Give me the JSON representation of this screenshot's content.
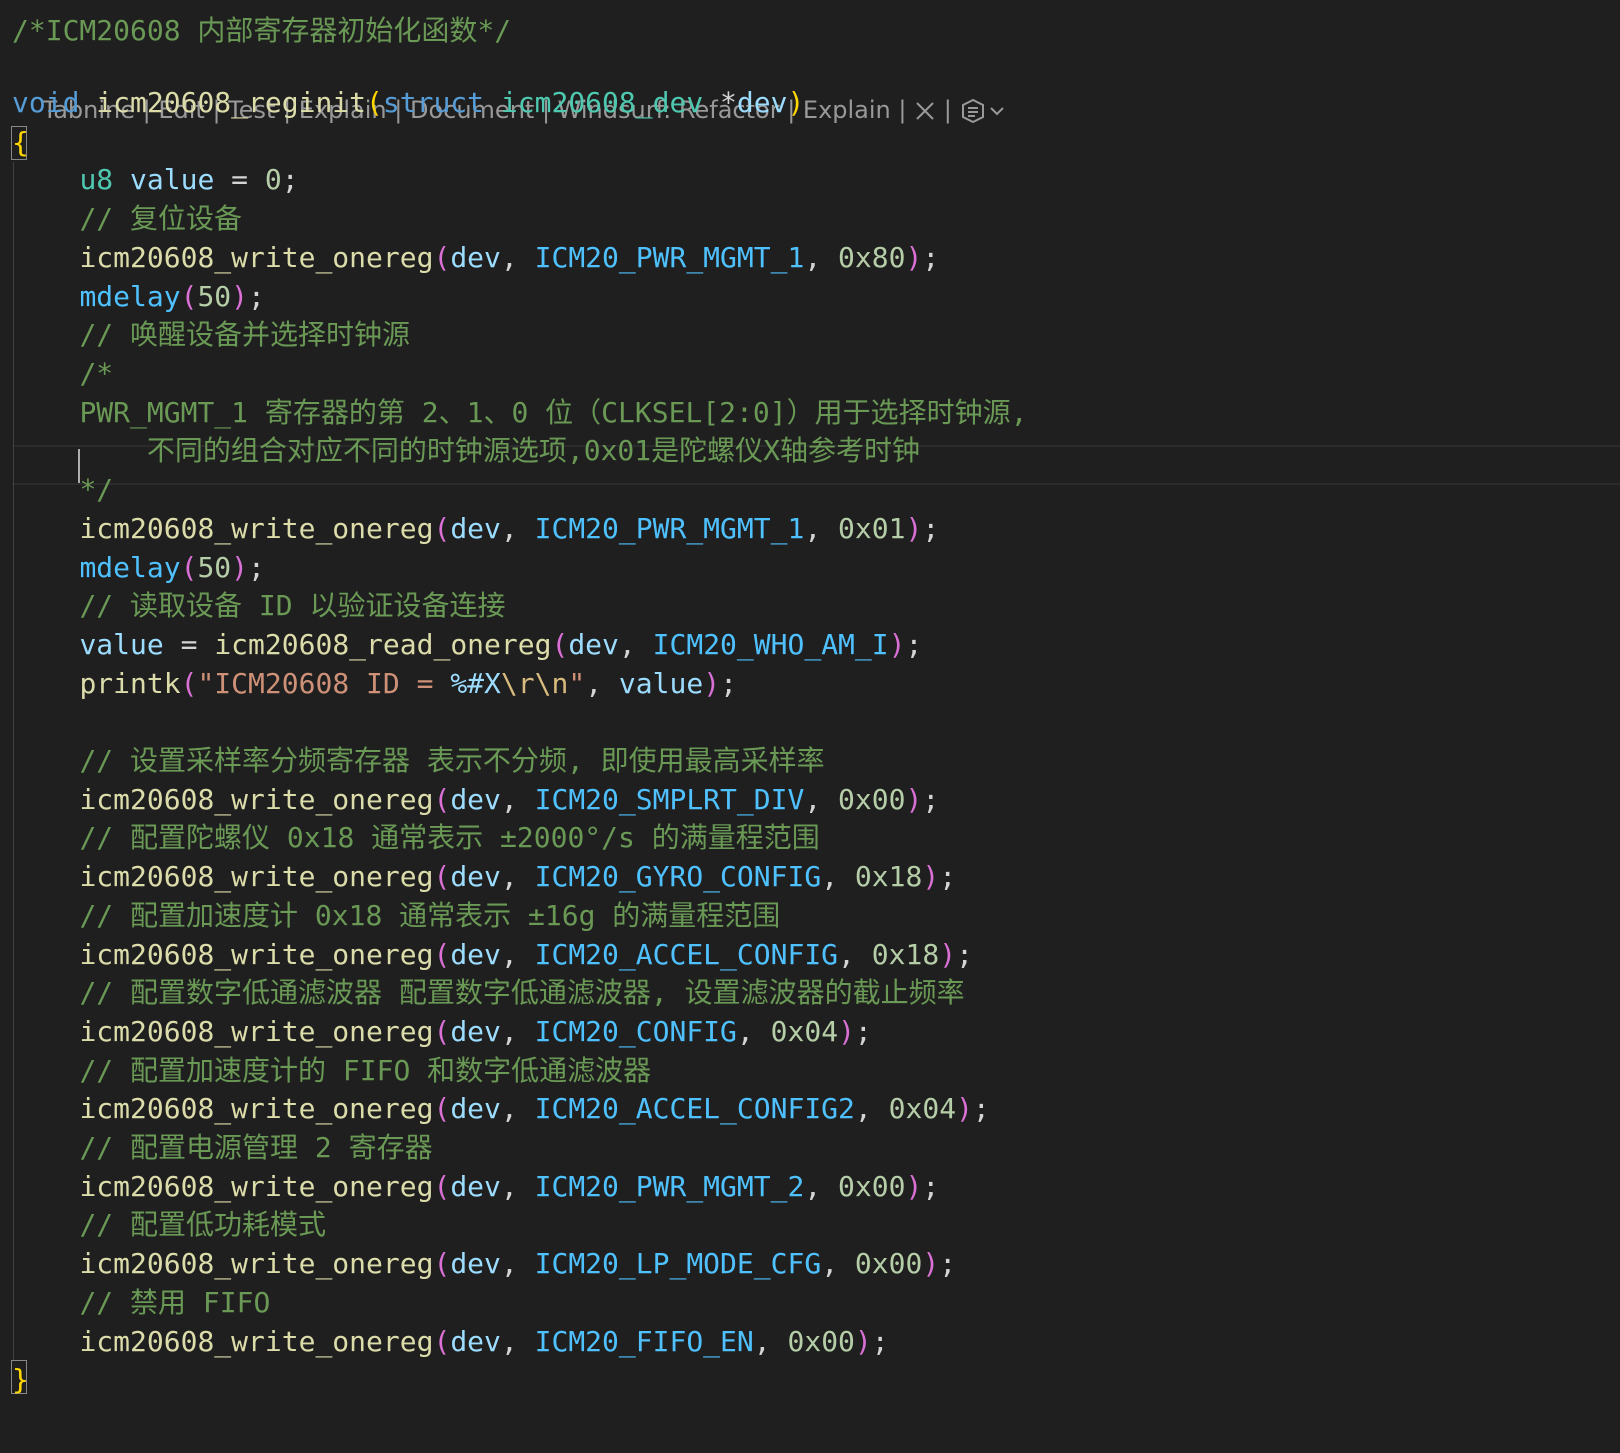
{
  "codelens": {
    "actions": [
      "Tabnine",
      "Edit",
      "Test",
      "Explain",
      "Document",
      "Windsurf: Refactor",
      "Explain"
    ],
    "separator": " | ",
    "close_icon": "close-icon",
    "windsurf_icon": "windsurf-icon",
    "chevron_icon": "chevron-down-icon"
  },
  "code": {
    "line_01": [
      [
        "cm",
        "/*ICM20608 内部寄存器初始化函数*/"
      ]
    ],
    "line_02": [
      [
        "kw",
        "void"
      ],
      [
        "op",
        " "
      ],
      [
        "fn",
        "icm20608_reginit"
      ],
      [
        "b1",
        "("
      ],
      [
        "kw",
        "struct"
      ],
      [
        "op",
        " "
      ],
      [
        "ty",
        "icm20608_dev"
      ],
      [
        "op",
        " *"
      ],
      [
        "va",
        "dev"
      ],
      [
        "b1",
        ")"
      ]
    ],
    "line_03": [
      [
        "b1",
        "{"
      ]
    ],
    "line_04": [
      [
        "op",
        "    "
      ],
      [
        "ty",
        "u8"
      ],
      [
        "op",
        " "
      ],
      [
        "va",
        "value"
      ],
      [
        "op",
        " = "
      ],
      [
        "nu",
        "0"
      ],
      [
        "op",
        ";"
      ]
    ],
    "line_05": [
      [
        "op",
        "    "
      ],
      [
        "cm",
        "// 复位设备"
      ]
    ],
    "line_06": [
      [
        "op",
        "    "
      ],
      [
        "fn",
        "icm20608_write_onereg"
      ],
      [
        "b2",
        "("
      ],
      [
        "va",
        "dev"
      ],
      [
        "op",
        ", "
      ],
      [
        "mc",
        "ICM20_PWR_MGMT_1"
      ],
      [
        "op",
        ", "
      ],
      [
        "nu",
        "0x80"
      ],
      [
        "b2",
        ")"
      ],
      [
        "op",
        ";"
      ]
    ],
    "line_07": [
      [
        "op",
        "    "
      ],
      [
        "mc",
        "mdelay"
      ],
      [
        "b2",
        "("
      ],
      [
        "nu",
        "50"
      ],
      [
        "b2",
        ")"
      ],
      [
        "op",
        ";"
      ]
    ],
    "line_08": [
      [
        "op",
        "    "
      ],
      [
        "cm",
        "// 唤醒设备并选择时钟源"
      ]
    ],
    "line_09": [
      [
        "op",
        "    "
      ],
      [
        "cm",
        "/*"
      ]
    ],
    "line_10": [
      [
        "op",
        "    "
      ],
      [
        "cm",
        "PWR_MGMT_1 寄存器的第 2、1、0 位（CLKSEL[2:0]）用于选择时钟源,"
      ]
    ],
    "line_11": [
      [
        "op",
        "        "
      ],
      [
        "cm",
        "不同的组合对应不同的时钟源选项,0x01是陀螺仪X轴参考时钟"
      ]
    ],
    "line_12": [
      [
        "op",
        "    "
      ],
      [
        "cm",
        "*/"
      ]
    ],
    "line_13": [
      [
        "op",
        "    "
      ],
      [
        "fn",
        "icm20608_write_onereg"
      ],
      [
        "b2",
        "("
      ],
      [
        "va",
        "dev"
      ],
      [
        "op",
        ", "
      ],
      [
        "mc",
        "ICM20_PWR_MGMT_1"
      ],
      [
        "op",
        ", "
      ],
      [
        "nu",
        "0x01"
      ],
      [
        "b2",
        ")"
      ],
      [
        "op",
        ";"
      ]
    ],
    "line_14": [
      [
        "op",
        "    "
      ],
      [
        "mc",
        "mdelay"
      ],
      [
        "b2",
        "("
      ],
      [
        "nu",
        "50"
      ],
      [
        "b2",
        ")"
      ],
      [
        "op",
        ";"
      ]
    ],
    "line_15": [
      [
        "op",
        "    "
      ],
      [
        "cm",
        "// 读取设备 ID 以验证设备连接"
      ]
    ],
    "line_16": [
      [
        "op",
        "    "
      ],
      [
        "va",
        "value"
      ],
      [
        "op",
        " = "
      ],
      [
        "fn",
        "icm20608_read_onereg"
      ],
      [
        "b2",
        "("
      ],
      [
        "va",
        "dev"
      ],
      [
        "op",
        ", "
      ],
      [
        "mc",
        "ICM20_WHO_AM_I"
      ],
      [
        "b2",
        ")"
      ],
      [
        "op",
        ";"
      ]
    ],
    "line_17": [
      [
        "op",
        "    "
      ],
      [
        "fn",
        "printk"
      ],
      [
        "b2",
        "("
      ],
      [
        "st",
        "\"ICM20608 ID = "
      ],
      [
        "va",
        "%#X"
      ],
      [
        "es",
        "\\r\\n"
      ],
      [
        "st",
        "\""
      ],
      [
        "op",
        ", "
      ],
      [
        "va",
        "value"
      ],
      [
        "b2",
        ")"
      ],
      [
        "op",
        ";"
      ]
    ],
    "line_18": [],
    "line_19": [
      [
        "op",
        "    "
      ],
      [
        "cm",
        "// 设置采样率分频寄存器 表示不分频, 即使用最高采样率"
      ]
    ],
    "line_20": [
      [
        "op",
        "    "
      ],
      [
        "fn",
        "icm20608_write_onereg"
      ],
      [
        "b2",
        "("
      ],
      [
        "va",
        "dev"
      ],
      [
        "op",
        ", "
      ],
      [
        "mc",
        "ICM20_SMPLRT_DIV"
      ],
      [
        "op",
        ", "
      ],
      [
        "nu",
        "0x00"
      ],
      [
        "b2",
        ")"
      ],
      [
        "op",
        ";"
      ]
    ],
    "line_21": [
      [
        "op",
        "    "
      ],
      [
        "cm",
        "// 配置陀螺仪 0x18 通常表示 ±2000°/s 的满量程范围"
      ]
    ],
    "line_22": [
      [
        "op",
        "    "
      ],
      [
        "fn",
        "icm20608_write_onereg"
      ],
      [
        "b2",
        "("
      ],
      [
        "va",
        "dev"
      ],
      [
        "op",
        ", "
      ],
      [
        "mc",
        "ICM20_GYRO_CONFIG"
      ],
      [
        "op",
        ", "
      ],
      [
        "nu",
        "0x18"
      ],
      [
        "b2",
        ")"
      ],
      [
        "op",
        ";"
      ]
    ],
    "line_23": [
      [
        "op",
        "    "
      ],
      [
        "cm",
        "// 配置加速度计 0x18 通常表示 ±16g 的满量程范围"
      ]
    ],
    "line_24": [
      [
        "op",
        "    "
      ],
      [
        "fn",
        "icm20608_write_onereg"
      ],
      [
        "b2",
        "("
      ],
      [
        "va",
        "dev"
      ],
      [
        "op",
        ", "
      ],
      [
        "mc",
        "ICM20_ACCEL_CONFIG"
      ],
      [
        "op",
        ", "
      ],
      [
        "nu",
        "0x18"
      ],
      [
        "b2",
        ")"
      ],
      [
        "op",
        ";"
      ]
    ],
    "line_25": [
      [
        "op",
        "    "
      ],
      [
        "cm",
        "// 配置数字低通滤波器 配置数字低通滤波器, 设置滤波器的截止频率"
      ]
    ],
    "line_26": [
      [
        "op",
        "    "
      ],
      [
        "fn",
        "icm20608_write_onereg"
      ],
      [
        "b2",
        "("
      ],
      [
        "va",
        "dev"
      ],
      [
        "op",
        ", "
      ],
      [
        "mc",
        "ICM20_CONFIG"
      ],
      [
        "op",
        ", "
      ],
      [
        "nu",
        "0x04"
      ],
      [
        "b2",
        ")"
      ],
      [
        "op",
        ";"
      ]
    ],
    "line_27": [
      [
        "op",
        "    "
      ],
      [
        "cm",
        "// 配置加速度计的 FIFO 和数字低通滤波器"
      ]
    ],
    "line_28": [
      [
        "op",
        "    "
      ],
      [
        "fn",
        "icm20608_write_onereg"
      ],
      [
        "b2",
        "("
      ],
      [
        "va",
        "dev"
      ],
      [
        "op",
        ", "
      ],
      [
        "mc",
        "ICM20_ACCEL_CONFIG2"
      ],
      [
        "op",
        ", "
      ],
      [
        "nu",
        "0x04"
      ],
      [
        "b2",
        ")"
      ],
      [
        "op",
        ";"
      ]
    ],
    "line_29": [
      [
        "op",
        "    "
      ],
      [
        "cm",
        "// 配置电源管理 2 寄存器"
      ]
    ],
    "line_30": [
      [
        "op",
        "    "
      ],
      [
        "fn",
        "icm20608_write_onereg"
      ],
      [
        "b2",
        "("
      ],
      [
        "va",
        "dev"
      ],
      [
        "op",
        ", "
      ],
      [
        "mc",
        "ICM20_PWR_MGMT_2"
      ],
      [
        "op",
        ", "
      ],
      [
        "nu",
        "0x00"
      ],
      [
        "b2",
        ")"
      ],
      [
        "op",
        ";"
      ]
    ],
    "line_31": [
      [
        "op",
        "    "
      ],
      [
        "cm",
        "// 配置低功耗模式"
      ]
    ],
    "line_32": [
      [
        "op",
        "    "
      ],
      [
        "fn",
        "icm20608_write_onereg"
      ],
      [
        "b2",
        "("
      ],
      [
        "va",
        "dev"
      ],
      [
        "op",
        ", "
      ],
      [
        "mc",
        "ICM20_LP_MODE_CFG"
      ],
      [
        "op",
        ", "
      ],
      [
        "nu",
        "0x00"
      ],
      [
        "b2",
        ")"
      ],
      [
        "op",
        ";"
      ]
    ],
    "line_33": [
      [
        "op",
        "    "
      ],
      [
        "cm",
        "// 禁用 FIFO"
      ]
    ],
    "line_34": [
      [
        "op",
        "    "
      ],
      [
        "fn",
        "icm20608_write_onereg"
      ],
      [
        "b2",
        "("
      ],
      [
        "va",
        "dev"
      ],
      [
        "op",
        ", "
      ],
      [
        "mc",
        "ICM20_FIFO_EN"
      ],
      [
        "op",
        ", "
      ],
      [
        "nu",
        "0x00"
      ],
      [
        "b2",
        ")"
      ],
      [
        "op",
        ";"
      ]
    ],
    "line_35": [
      [
        "b1",
        "}"
      ]
    ]
  },
  "colors": {
    "background": "#1f1f1f",
    "comment": "#6a9955",
    "keyword": "#569cd6",
    "type": "#4ec9b0",
    "function": "#dcdcaa",
    "variable": "#9cdcfe",
    "macro": "#4fc1ff",
    "number": "#b5cea8",
    "string": "#ce9178",
    "bracket_1": "#ffd700",
    "bracket_2": "#da70d6"
  }
}
